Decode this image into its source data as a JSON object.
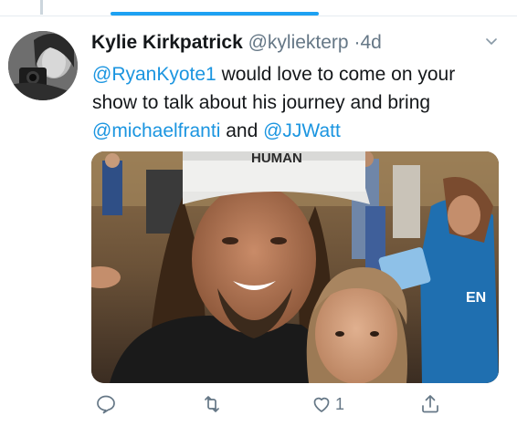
{
  "tweet": {
    "author_name": "Kylie Kirkpatrick",
    "author_handle": "@kyliekterp",
    "separator": "·",
    "timestamp": "4d",
    "text_segments": [
      {
        "text": "@RyanKyote1",
        "type": "mention"
      },
      {
        "text": " would love to come on your show to talk about his journey and bring ",
        "type": "text"
      },
      {
        "text": "@michaelfranti",
        "type": "mention"
      },
      {
        "text": " and ",
        "type": "text"
      },
      {
        "text": "@JJWatt",
        "type": "mention"
      }
    ],
    "hat_text": "HUMAN",
    "shirt_text": "EN",
    "like_count": "1"
  },
  "icons": {
    "reply": "reply-icon",
    "retweet": "retweet-icon",
    "like": "heart-icon",
    "share": "share-icon",
    "menu": "chevron-down-icon"
  },
  "colors": {
    "accent": "#1da1f2",
    "mention": "#1b95e0",
    "muted": "#657786",
    "text": "#14171a"
  }
}
